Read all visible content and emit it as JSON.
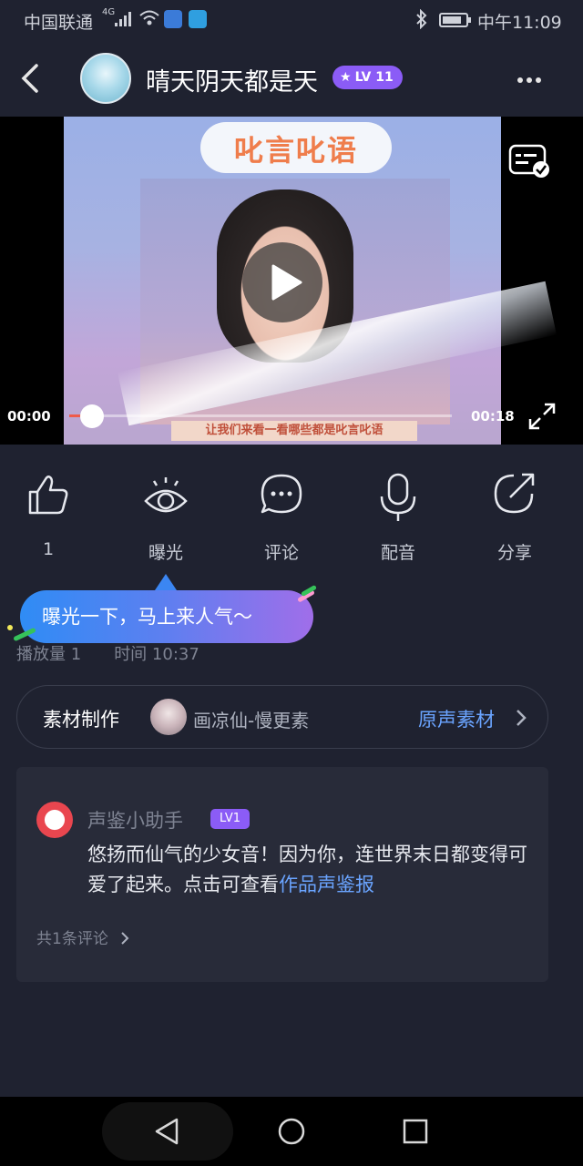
{
  "status_bar": {
    "carrier": "中国联通",
    "network": "4G",
    "time": "中午11:09"
  },
  "header": {
    "username": "晴天阴天都是天",
    "level": "LV 11",
    "icons": [
      "back-icon",
      "more-icon"
    ]
  },
  "video": {
    "frame_title": "叱言叱语",
    "frame_caption": "让我们来看一看哪些都是叱言叱语",
    "current_time": "00:00",
    "total_time": "00:18",
    "progress": 0.04,
    "accent_color": "#f05a4a"
  },
  "actions": [
    {
      "name": "like",
      "icon": "thumbs-up-icon",
      "label": "1"
    },
    {
      "name": "exposure",
      "icon": "eye-icon",
      "label": "曝光"
    },
    {
      "name": "comment",
      "icon": "comment-bubble-icon",
      "label": "评论"
    },
    {
      "name": "dub",
      "icon": "microphone-icon",
      "label": "配音"
    },
    {
      "name": "share",
      "icon": "share-arrow-icon",
      "label": "分享"
    }
  ],
  "tooltip": {
    "text": "曝光一下，马上来人气～"
  },
  "stats": {
    "plays": "播放量 1",
    "time": "时间 10:37"
  },
  "material": {
    "title": "素材制作",
    "creator": "画凉仙-慢更素",
    "link": "原声素材"
  },
  "comment": {
    "author": "声鉴小助手",
    "level": "LV1",
    "text_main": "悠扬而仙气的少女音！因为你，连世界末日都变得可爱了起来。点击可查看",
    "text_link": "作品声鉴报",
    "count": "共1条评论"
  },
  "colors": {
    "background": "#1f2230",
    "card": "#282b39",
    "link": "#6aa4ff",
    "badge": "#8b5cf6"
  }
}
